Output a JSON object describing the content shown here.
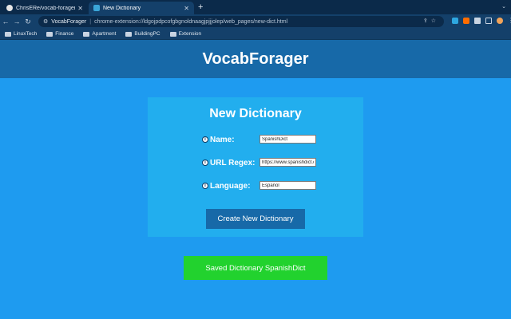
{
  "browser": {
    "tabs": [
      {
        "title": "ChrisERe/vocab-forager: Chro",
        "active": false
      },
      {
        "title": "New Dictionary",
        "active": true
      }
    ],
    "new_tab_label": "+",
    "address": {
      "site_label": "VocabForager",
      "url": "chrome-extension://ldgojpdpcofgbgnoldnaagjpjjjolep/web_pages/new-dict.html"
    },
    "bookmarks": [
      "LinuxTech",
      "Finance",
      "Apartment",
      "BuildingPC",
      "Extension"
    ]
  },
  "header": {
    "title": "VocabForager"
  },
  "form": {
    "title": "New Dictionary",
    "fields": [
      {
        "label": "Name:",
        "value": "SpanishDict"
      },
      {
        "label": "URL Regex:",
        "value": "https://www.spanishdict.co"
      },
      {
        "label": "Language:",
        "value": "Español"
      }
    ],
    "submit_label": "Create New Dictionary"
  },
  "status": {
    "message": "Saved Dictionary SpanishDict",
    "color": "#22d22e"
  },
  "colors": {
    "page_bg": "#1e9bf0",
    "header_bg": "#1769a8",
    "card_bg": "#22aeee",
    "button_bg": "#1769a8"
  },
  "icons": {
    "info": "info-icon"
  }
}
